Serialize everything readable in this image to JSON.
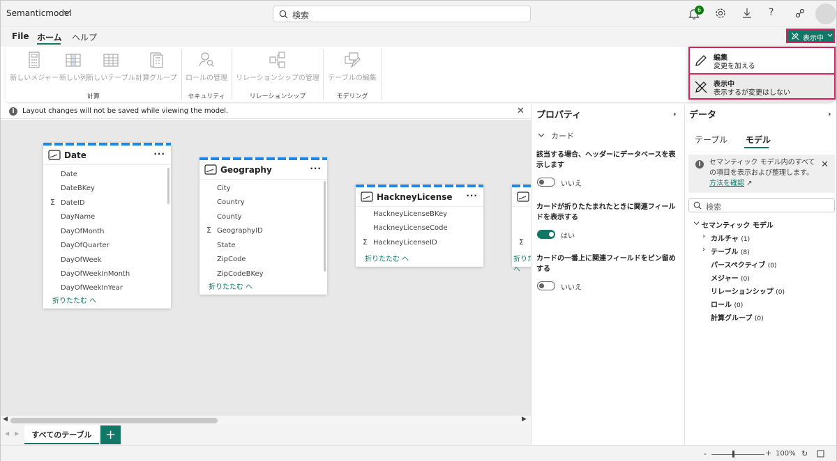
{
  "topbar": {
    "model_name": "Semanticmodel",
    "search_placeholder": "検索",
    "notif_count": "6"
  },
  "menu": {
    "file": "File",
    "home": "ホーム",
    "help": "ヘルプ",
    "mode_label": "表示中"
  },
  "ribbon": {
    "buttons": [
      "新しいメジャー",
      "新しい列",
      "新しいテーブル",
      "計算グループ",
      "ロールの管理",
      "リレーションシップの管理",
      "テーブルの編集"
    ],
    "groups": [
      "計算",
      "セキュリティ",
      "リレーションシップ",
      "モデリング"
    ]
  },
  "mode_menu": {
    "edit_title": "編集",
    "edit_desc": "変更を加える",
    "view_title": "表示中",
    "view_desc": "表示するが変更はしない"
  },
  "infobar": {
    "text": "Layout changes will not be saved while viewing the model."
  },
  "tables": {
    "date": {
      "title": "Date",
      "fields": [
        "Date",
        "DateBKey",
        "DateID",
        "DayName",
        "DayOfMonth",
        "DayOfQuarter",
        "DayOfWeek",
        "DayOfWeekInMonth",
        "DayOfWeekInYear"
      ],
      "collapse": "折りたたむ ヘ"
    },
    "geography": {
      "title": "Geography",
      "fields": [
        "City",
        "Country",
        "County",
        "GeographyID",
        "State",
        "ZipCode",
        "ZipCodeBKey"
      ],
      "collapse": "折りたたむ ヘ"
    },
    "hackney": {
      "title": "HackneyLicense",
      "fields": [
        "HackneyLicenseBKey",
        "HackneyLicenseCode",
        "HackneyLicenseID"
      ],
      "collapse": "折りたたむ ヘ"
    },
    "sigma": "Σ",
    "dots": "···"
  },
  "tabs": {
    "all": "すべてのテーブル",
    "add": "+"
  },
  "properties": {
    "title": "プロパティ",
    "section": "カード",
    "q1": "該当する場合、ヘッダーにデータベースを表示します",
    "a1": "いいえ",
    "q2": "カードが折りたたまれたときに関連フィールドを表示する",
    "a2": "はい",
    "q3": "カードの一番上に関連フィールドをピン留めする",
    "a3": "いいえ"
  },
  "data_pane": {
    "title": "データ",
    "tab_table": "テーブル",
    "tab_model": "モデル",
    "info_text": "セマンティック モデル内のすべての項目を表示および整理します。",
    "info_link": "方法を確認",
    "search_placeholder": "検索",
    "root": "セマンティック モデル",
    "items": [
      {
        "label": "カルチャ",
        "count": "(1)"
      },
      {
        "label": "テーブル",
        "count": "(8)"
      },
      {
        "label": "パースペクティブ",
        "count": "(0)"
      },
      {
        "label": "メジャー",
        "count": "(0)"
      },
      {
        "label": "リレーションシップ",
        "count": "(0)"
      },
      {
        "label": "ロール",
        "count": "(0)"
      },
      {
        "label": "計算グループ",
        "count": "(0)"
      }
    ]
  },
  "status": {
    "zoom": "100%"
  },
  "colors": {
    "accent": "#117865",
    "highlight": "#d6245d",
    "stripe": "#1e88e5"
  }
}
